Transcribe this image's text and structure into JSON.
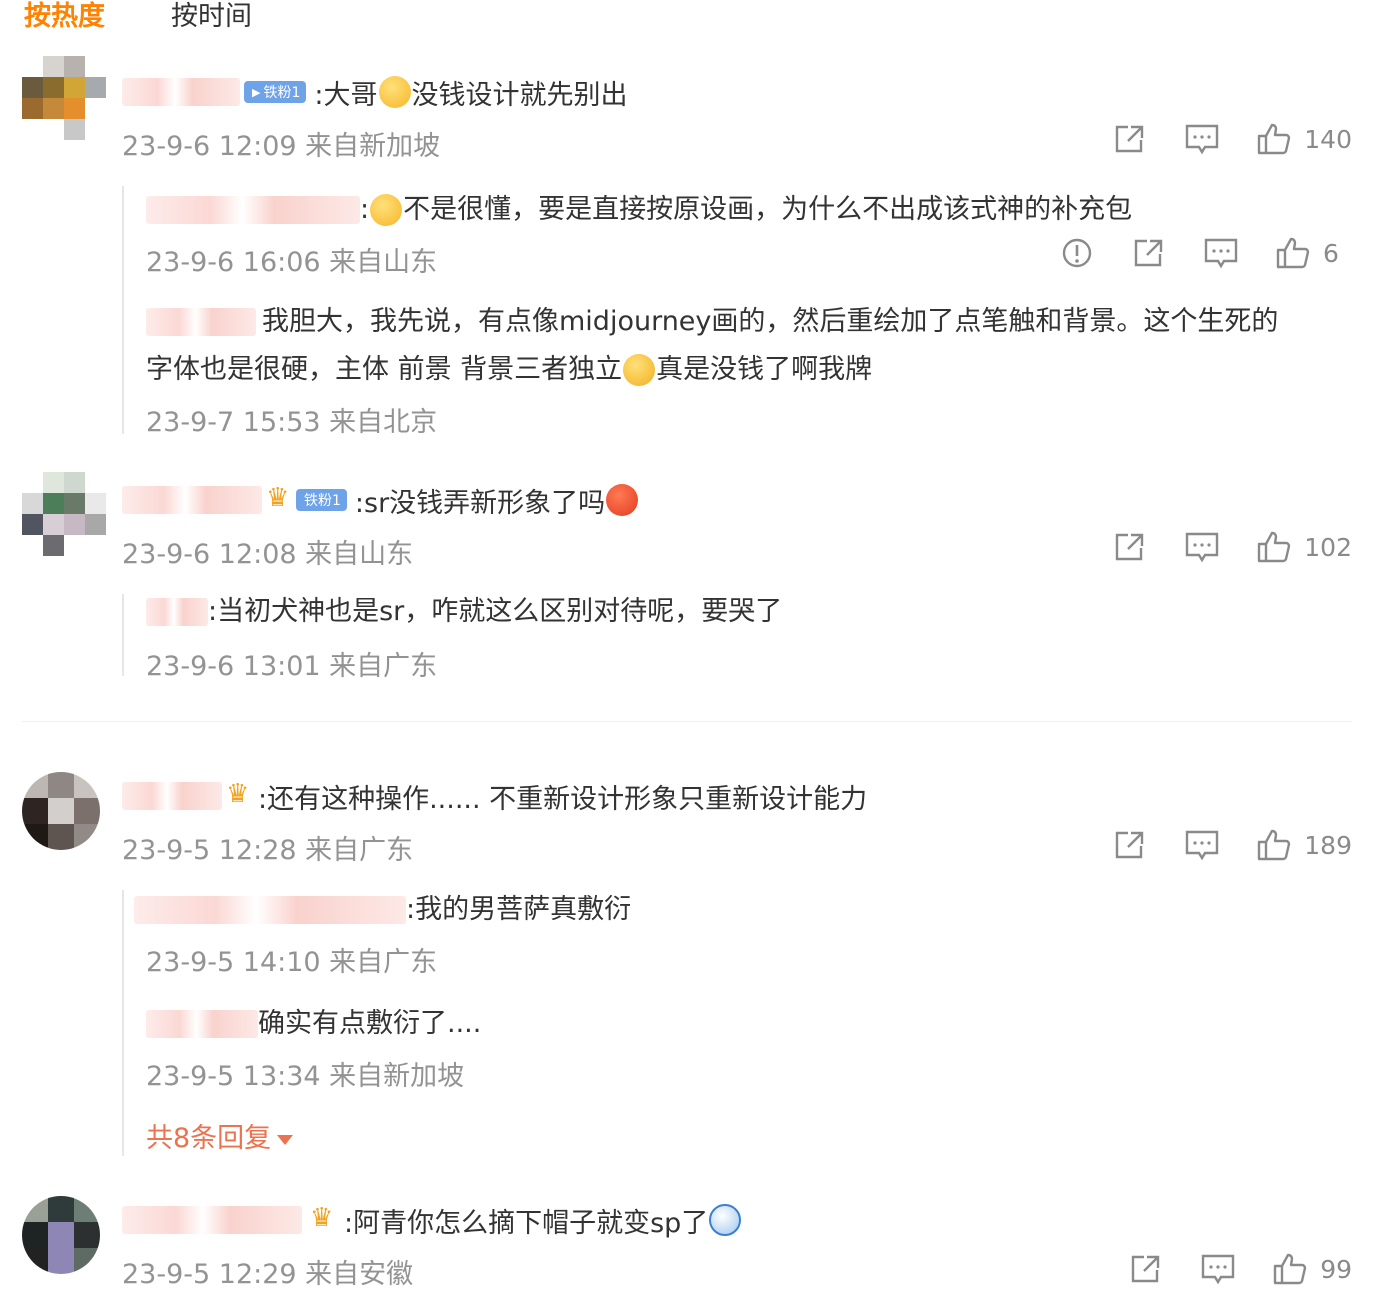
{
  "tabs": [
    "按热度",
    "按时间"
  ],
  "comments": [
    {
      "badge": "铁粉1",
      "text1": ":大哥",
      "text2": "没钱设计就先别出",
      "meta": "23-9-6 12:09 来自新加坡",
      "likes": "140",
      "replies": [
        {
          "text1": ":",
          "text2": "不是很懂，要是直接按原设画，为什么不出成该式神的补充包",
          "meta": "23-9-6 16:06 来自山东",
          "likes": "6"
        },
        {
          "text_a": "我胆大，我先说，有点像midjourney画的，然后重绘加了点笔触和背景。这个生死的",
          "text_b1": "字体也是很硬，主体 前景 背景三者独立",
          "text_b2": "真是没钱了啊我牌",
          "meta": "23-9-7 15:53 来自北京"
        }
      ]
    },
    {
      "badge": "铁粉1",
      "text1": ":sr没钱弄新形象了吗",
      "meta": "23-9-6 12:08 来自山东",
      "likes": "102",
      "replies": [
        {
          "text": ":当初犬神也是sr，咋就这么区别对待呢，要哭了",
          "meta": "23-9-6 13:01 来自广东"
        }
      ]
    },
    {
      "text1": ":还有这种操作......  不重新设计形象只重新设计能力",
      "meta": "23-9-5 12:28 来自广东",
      "likes": "189",
      "replies": [
        {
          "text": ":我的男菩萨真敷衍",
          "meta": "23-9-5 14:10 来自广东"
        },
        {
          "text": "确实有点敷衍了....",
          "meta": "23-9-5 13:34 来自新加坡"
        }
      ],
      "more": "共8条回复"
    },
    {
      "text1": ":阿青你怎么摘下帽子就变sp了",
      "meta": "23-9-5 12:29 来自安徽",
      "likes": "99"
    }
  ],
  "colors": {
    "accent": "#ff8200",
    "meta": "#939393",
    "more": "#eb7350",
    "badge": "#6fa3e8"
  }
}
